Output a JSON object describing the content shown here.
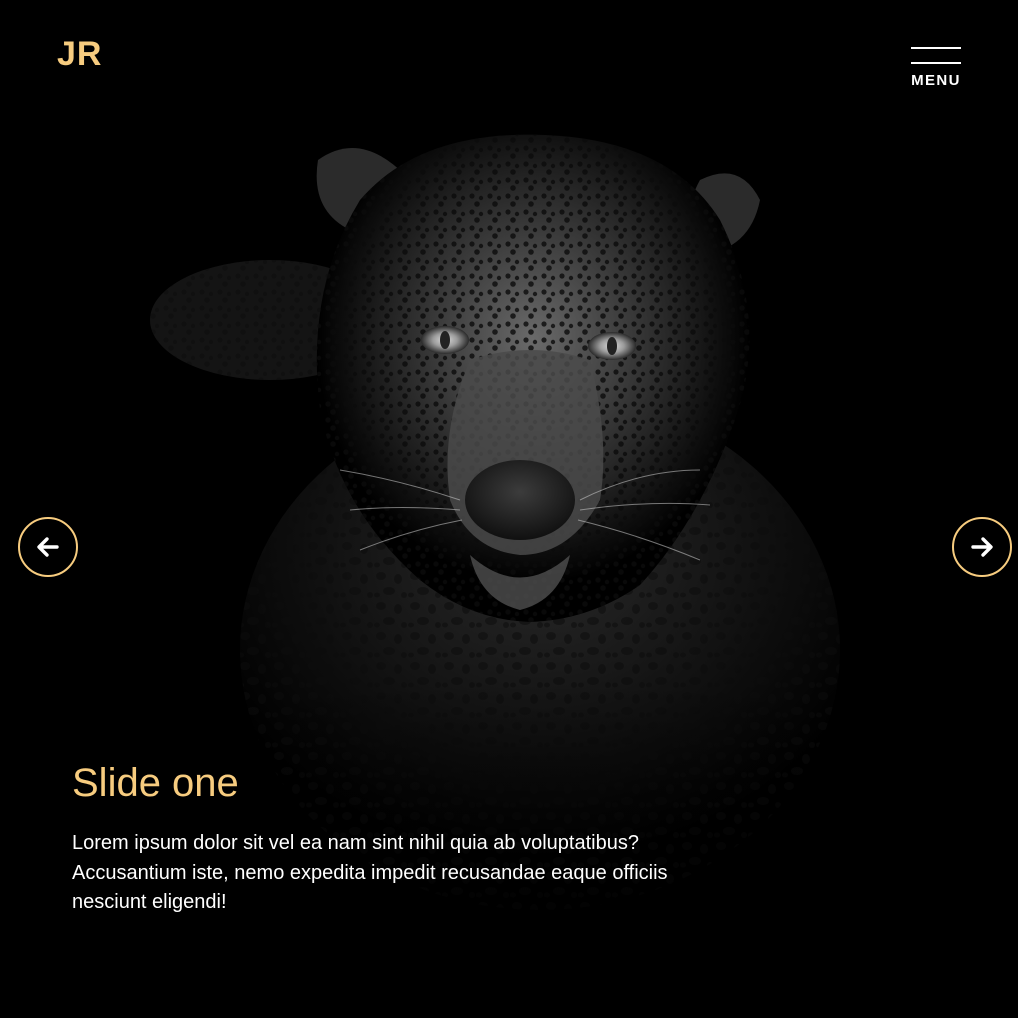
{
  "brand": {
    "logo_text": "JR",
    "accent_color": "#f7cc7f"
  },
  "header": {
    "menu_label": "MENU",
    "menu_icon": "hamburger-icon"
  },
  "carousel": {
    "prev_icon": "arrow-left-icon",
    "next_icon": "arrow-right-icon",
    "active_slide": {
      "title": "Slide one",
      "description": "Lorem ipsum dolor sit vel ea nam sint nihil quia ab voluptatibus? Accusantium iste, nemo expedita impedit recusandae eaque officiis nesciunt eligendi!"
    }
  },
  "colors": {
    "background": "#000000",
    "text": "#ffffff",
    "accent": "#f7cc7f"
  }
}
